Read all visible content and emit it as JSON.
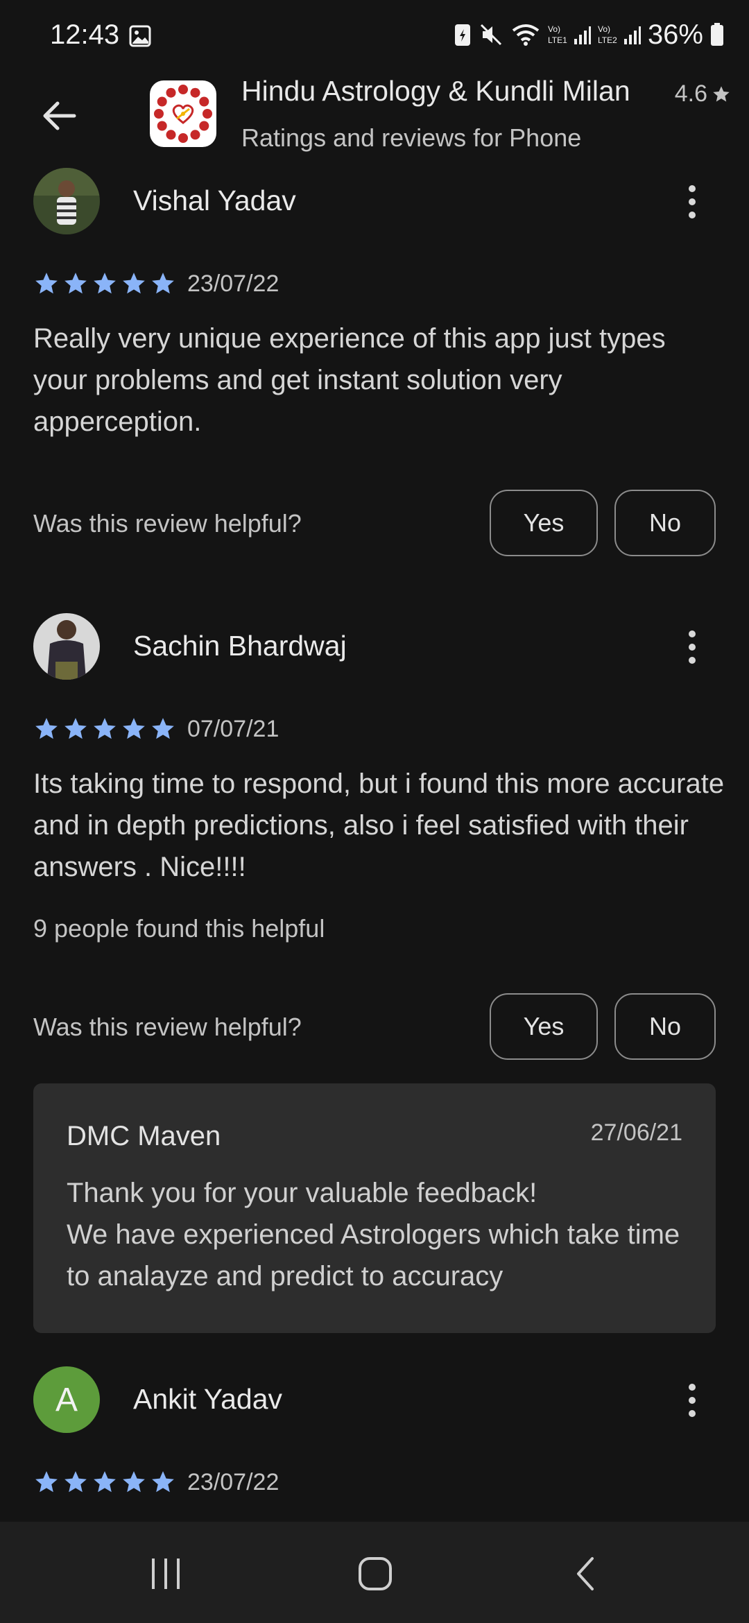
{
  "status_bar": {
    "time": "12:43",
    "battery_pct": "36%",
    "net_label_1": "Vo)\nLTE1",
    "net_label_2": "Vo)\nLTE2"
  },
  "header": {
    "back_icon": "arrow-left-icon",
    "app_title": "Hindu Astrology & Kundli Milan",
    "subtitle": "Ratings and reviews for Phone",
    "rating": "4.6"
  },
  "reviews": [
    {
      "name": "Vishal Yadav",
      "stars": 5,
      "date": "23/07/22",
      "text": "Really very unique experience of this app just types your problems and get instant solution very apperception.",
      "helpful_question": "Was this review helpful?",
      "yes_label": "Yes",
      "no_label": "No"
    },
    {
      "name": "Sachin Bhardwaj",
      "stars": 5,
      "date": "07/07/21",
      "text": "Its taking time to respond, but i found this more accurate and in depth predictions, also i feel satisfied with their answers . Nice!!!!",
      "helpful_count": "9 people found this helpful",
      "helpful_question": "Was this review helpful?",
      "yes_label": "Yes",
      "no_label": "No",
      "developer_reply": {
        "name": "DMC Maven",
        "date": "27/06/21",
        "text": "Thank you for your valuable feedback!\nWe have experienced  Astrologers which take time to analayze and predict to accuracy"
      }
    },
    {
      "name": "Ankit Yadav",
      "avatar_letter": "A",
      "stars": 5,
      "date": "23/07/22"
    }
  ],
  "colors": {
    "background": "#141414",
    "star": "#8ab4f8",
    "avatar_green": "#5d9c3b",
    "reply_bg": "#2d2d2d"
  }
}
